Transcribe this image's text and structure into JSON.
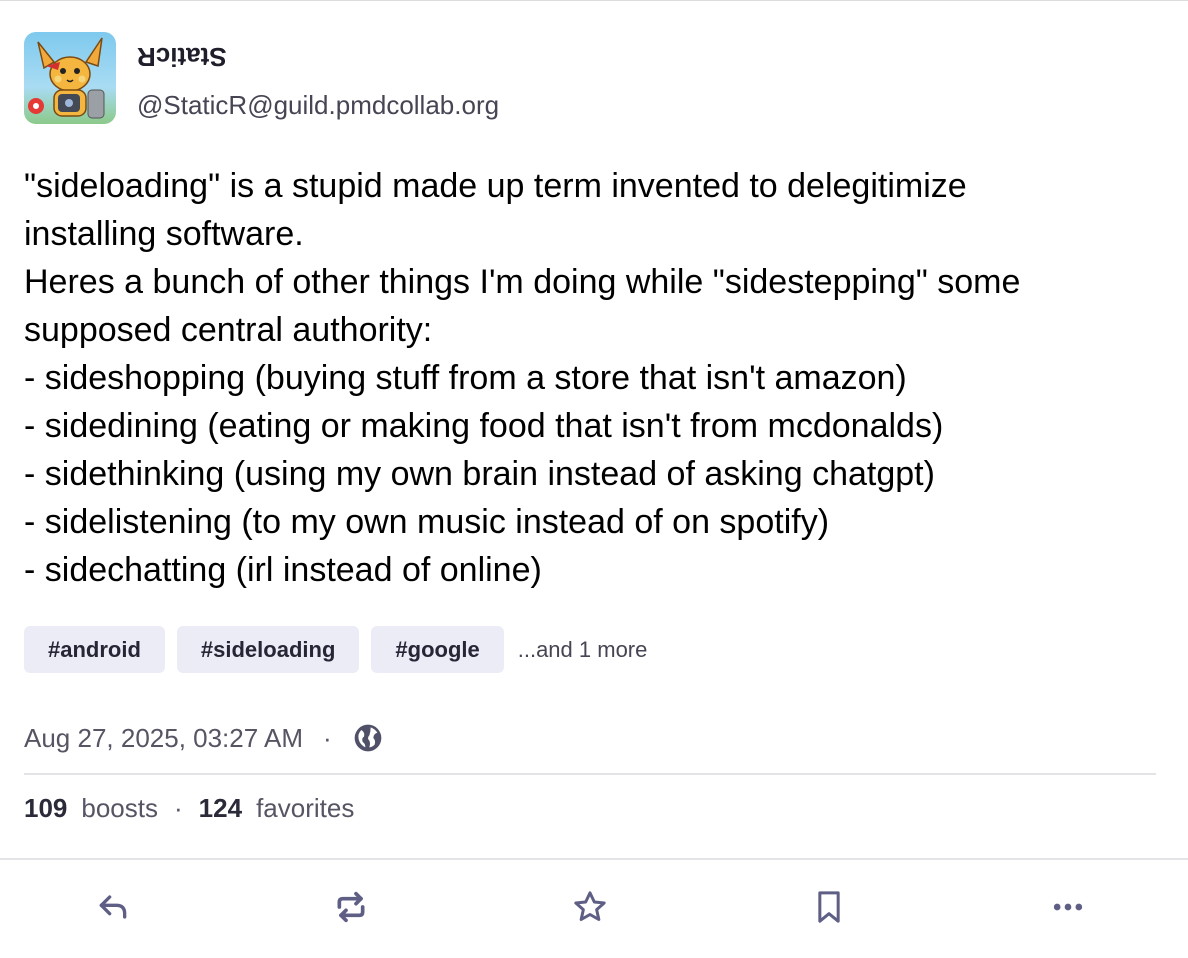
{
  "author": {
    "display_name": "StaticR",
    "account": "@StaticR@guild.pmdcollab.org",
    "avatar_icon": "pikachu-avatar-icon"
  },
  "post": {
    "lines": [
      "\"sideloading\" is a stupid made up term invented to delegitimize",
      "installing software.",
      "Heres a bunch of other things I'm doing while \"sidestepping\" some",
      "supposed central authority:",
      "- sideshopping (buying stuff from a store that isn't amazon)",
      "- sidedining (eating or making food that isn't from mcdonalds)",
      "- sidethinking (using my own brain instead of asking chatgpt)",
      "- sidelistening (to my own music instead of on spotify)",
      "- sidechatting (irl instead of online)"
    ],
    "tags": [
      "#android",
      "#sideloading",
      "#google"
    ],
    "more_tags": "...and 1 more"
  },
  "meta": {
    "timestamp": "Aug 27, 2025, 03:27 AM",
    "separator": "·",
    "visibility_icon": "globe-icon"
  },
  "stats": {
    "boosts_count": "109",
    "boosts_label": "boosts",
    "separator": "·",
    "favorites_count": "124",
    "favorites_label": "favorites"
  },
  "actions": [
    {
      "name": "reply",
      "icon": "reply-icon"
    },
    {
      "name": "boost",
      "icon": "boost-icon"
    },
    {
      "name": "favorite",
      "icon": "star-icon"
    },
    {
      "name": "bookmark",
      "icon": "bookmark-icon"
    },
    {
      "name": "more",
      "icon": "more-icon"
    }
  ],
  "colors": {
    "tag_bg": "#ececf7",
    "icon": "#5f5f86",
    "text_secondary": "#555563"
  }
}
